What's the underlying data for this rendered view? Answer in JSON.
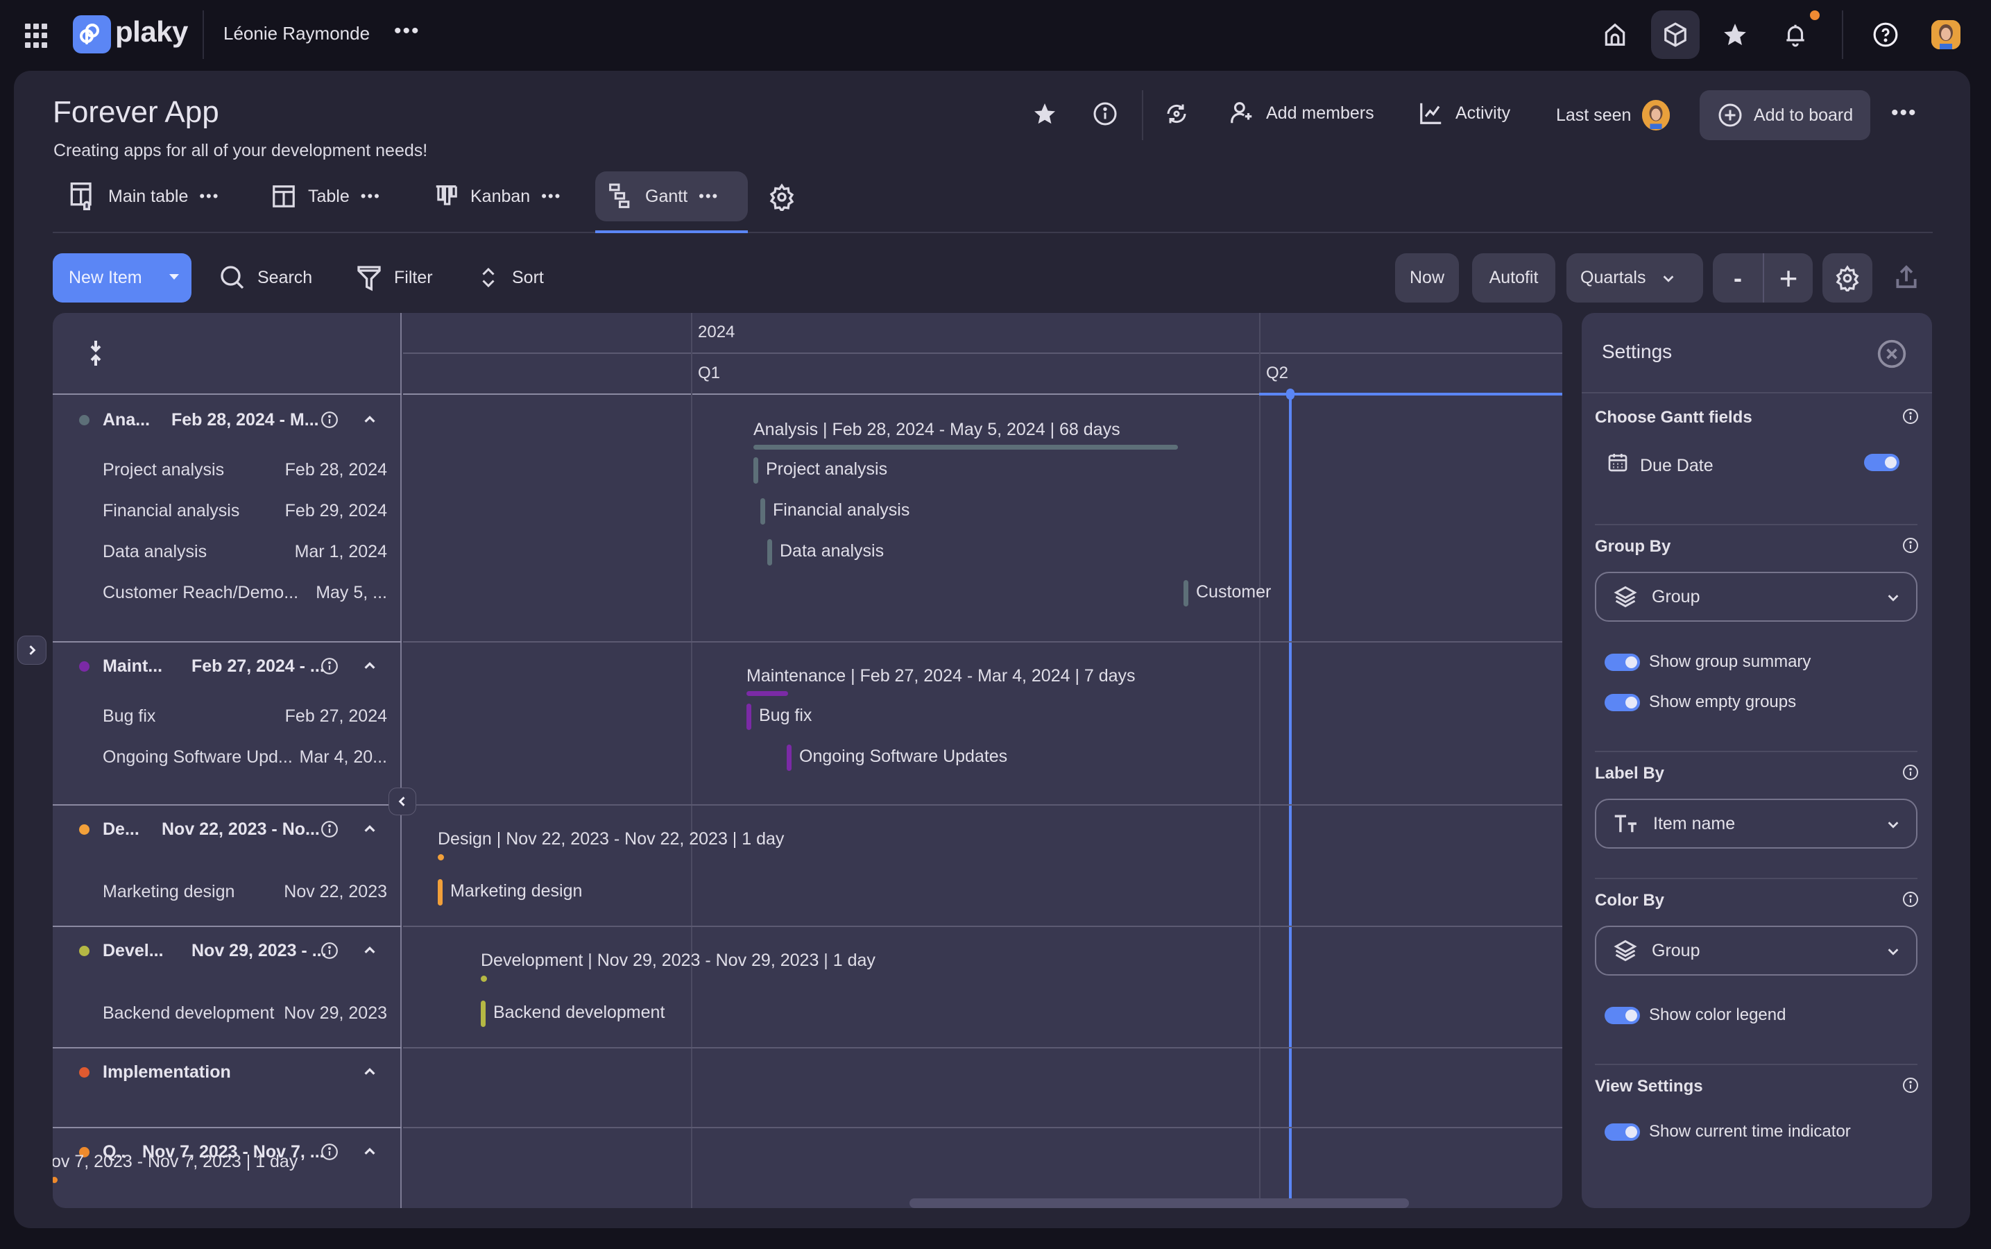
{
  "topbar": {
    "brand": "plaky",
    "workspace": "Léonie Raymonde",
    "more": "•••",
    "icons": [
      "apps-grid-icon",
      "home-icon",
      "boards-cube-icon",
      "favorites-star-icon",
      "notifications-bell-icon",
      "help-icon",
      "user-avatar"
    ],
    "notification_dot_color": "#f08a33"
  },
  "board": {
    "title": "Forever App",
    "description": "Creating apps for all of your development needs!",
    "actions": {
      "add_members": "Add members",
      "activity": "Activity",
      "last_seen": "Last seen",
      "add_to_board": "Add to board",
      "more": "•••"
    }
  },
  "views": {
    "tabs": [
      {
        "label": "Main table",
        "more": "•••",
        "active": false
      },
      {
        "label": "Table",
        "more": "•••",
        "active": false
      },
      {
        "label": "Kanban",
        "more": "•••",
        "active": false
      },
      {
        "label": "Gantt",
        "more": "•••",
        "active": true
      }
    ]
  },
  "toolbar": {
    "new_item": "New Item",
    "search": "Search",
    "filter": "Filter",
    "sort": "Sort",
    "now": "Now",
    "autofit": "Autofit",
    "scale": "Quartals",
    "zoom_out": "-",
    "zoom_in": "+"
  },
  "timeline": {
    "year": "2024",
    "quarters": [
      "Q1",
      "Q2"
    ]
  },
  "groups": [
    {
      "name": "Ana...",
      "range": "Feb 28, 2024 - M...",
      "color": "#5d6f78",
      "summary": "Analysis | Feb 28, 2024 - May 5, 2024 | 68 days",
      "items": [
        {
          "name": "Project analysis",
          "date": "Feb 28, 2024",
          "bar_label": "Project analysis"
        },
        {
          "name": "Financial analysis",
          "date": "Feb 29, 2024",
          "bar_label": "Financial analysis"
        },
        {
          "name": "Data analysis",
          "date": "Mar 1, 2024",
          "bar_label": "Data analysis"
        },
        {
          "name": "Customer Reach/Demo...",
          "date": "May 5, ...",
          "bar_label": "Customer"
        }
      ]
    },
    {
      "name": "Maint...",
      "range": "Feb 27, 2024 - ...",
      "color": "#7b2aa6",
      "summary": "Maintenance | Feb 27, 2024 - Mar 4, 2024 | 7 days",
      "items": [
        {
          "name": "Bug fix",
          "date": "Feb 27, 2024",
          "bar_label": "Bug fix"
        },
        {
          "name": "Ongoing Software Upd...",
          "date": "Mar 4, 20...",
          "bar_label": "Ongoing Software Updates"
        }
      ]
    },
    {
      "name": "De...",
      "range": "Nov 22, 2023 - No...",
      "color": "#f2a03a",
      "summary": "Design | Nov 22, 2023 - Nov 22, 2023 | 1 day",
      "items": [
        {
          "name": "Marketing design",
          "date": "Nov 22, 2023",
          "bar_label": "Marketing design"
        }
      ]
    },
    {
      "name": "Devel...",
      "range": "Nov 29, 2023 - ...",
      "color": "#b5b844",
      "summary": "Development | Nov 29, 2023 - Nov 29, 2023 | 1 day",
      "items": [
        {
          "name": "Backend development",
          "date": "Nov 29, 2023",
          "bar_label": "Backend development"
        }
      ]
    },
    {
      "name": "Implementation",
      "range": "",
      "color": "#e05a30",
      "summary": "",
      "items": []
    },
    {
      "name": "Q..",
      "range": "Nov 7, 2023 - Nov 7, ...",
      "color": "#ee8a2c",
      "summary": "ov 7, 2023 - Nov 7, 2023 | 1 day",
      "items": []
    }
  ],
  "settings": {
    "title": "Settings",
    "gantt_fields": {
      "heading": "Choose Gantt fields",
      "field": "Due Date",
      "enabled": true
    },
    "group_by": {
      "heading": "Group By",
      "value": "Group",
      "show_group_summary": "Show group summary",
      "show_empty_groups": "Show empty groups"
    },
    "label_by": {
      "heading": "Label By",
      "value": "Item name"
    },
    "color_by": {
      "heading": "Color By",
      "value": "Group",
      "show_color_legend": "Show color legend"
    },
    "view_settings": {
      "heading": "View Settings",
      "show_current_time": "Show current time indicator"
    }
  },
  "colors": {
    "accent": "#5b86f5",
    "panel": "#393850",
    "background": "#262535"
  }
}
